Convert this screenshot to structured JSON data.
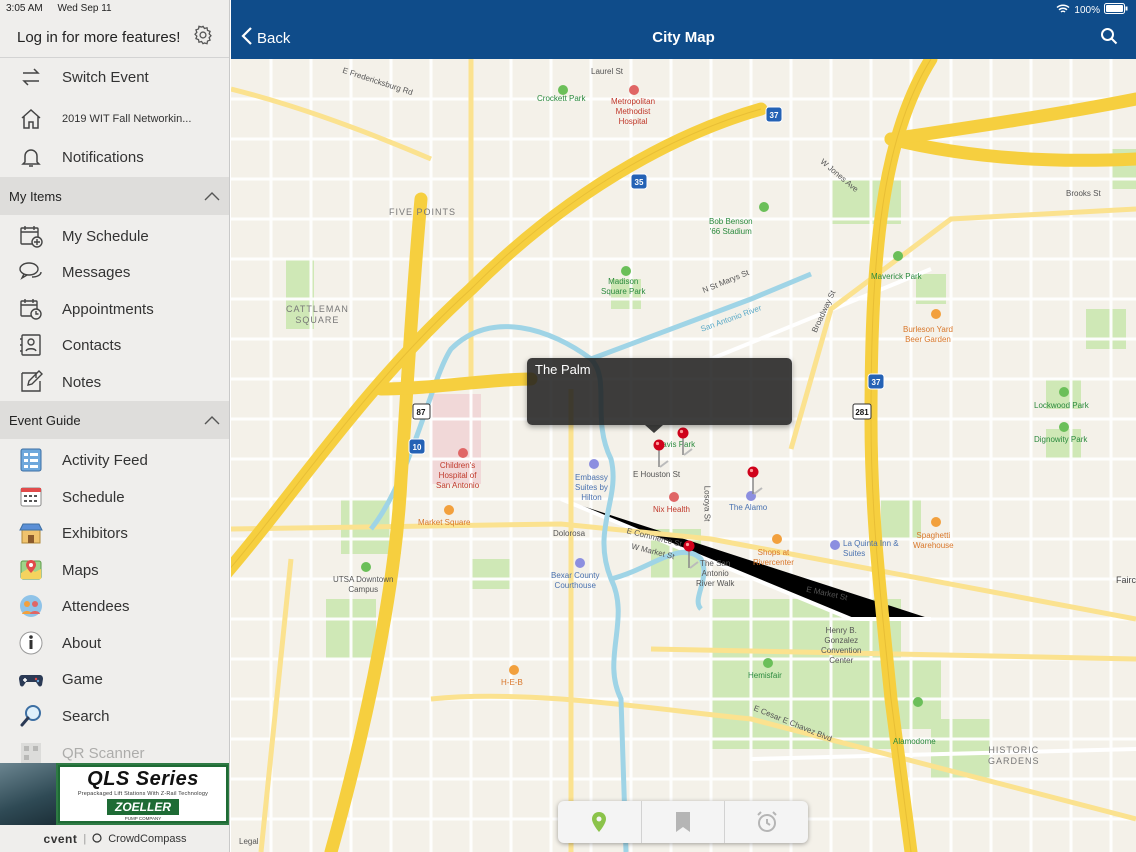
{
  "status_bar": {
    "time": "3:05 AM",
    "date": "Wed Sep 11",
    "battery": "100%"
  },
  "sidebar": {
    "login_text": "Log in for more features!",
    "top_items": [
      {
        "label": "Switch Event",
        "icon": "switch-arrows-icon"
      },
      {
        "label": "2019 WIT Fall Networkin...",
        "icon": "home-icon"
      },
      {
        "label": "Notifications",
        "icon": "bell-icon"
      }
    ],
    "my_items": {
      "title": "My Items",
      "items": [
        {
          "label": "My Schedule",
          "icon": "calendar-plus-icon"
        },
        {
          "label": "Messages",
          "icon": "chat-bubbles-icon"
        },
        {
          "label": "Appointments",
          "icon": "appointment-clock-icon"
        },
        {
          "label": "Contacts",
          "icon": "contact-card-icon"
        },
        {
          "label": "Notes",
          "icon": "notes-pencil-icon"
        }
      ]
    },
    "event_guide": {
      "title": "Event Guide",
      "items": [
        {
          "label": "Activity Feed",
          "icon": "activity-feed-icon"
        },
        {
          "label": "Schedule",
          "icon": "schedule-grid-icon"
        },
        {
          "label": "Exhibitors",
          "icon": "exhibitors-store-icon"
        },
        {
          "label": "Maps",
          "icon": "maps-icon"
        },
        {
          "label": "Attendees",
          "icon": "attendees-icon"
        },
        {
          "label": "About",
          "icon": "info-icon"
        },
        {
          "label": "Game",
          "icon": "gamepad-icon"
        },
        {
          "label": "Search",
          "icon": "search-icon"
        },
        {
          "label": "QR Scanner",
          "icon": "qr-scanner-icon"
        }
      ]
    },
    "ad": {
      "title": "QLS Series",
      "subtitle": "Prepackaged Lift Stations With Z-Rail Technology",
      "brand": "ZOELLER",
      "company": "PUMP COMPANY"
    },
    "footer": {
      "brand1": "cvent",
      "brand2": "CrowdCompass"
    }
  },
  "navbar": {
    "back_label": "Back",
    "title": "City Map"
  },
  "map": {
    "callout_title": "The Palm",
    "legal": "Legal",
    "labels": {
      "laurel": "Laurel St",
      "crockett": "Crockett Park",
      "metro": "Metropolitan\nMethodist\nHospital",
      "fredericksburg": "E Fredericksburg Rd",
      "fivepoints": "FIVE POINTS",
      "cattleman": "CATTLEMAN\nSQUARE",
      "bobbenson": "Bob Benson\n'66 Stadium",
      "madison": "Madison\nSquare Park",
      "maverick": "Maverick Park",
      "burleson": "Burleson Yard\nBeer Garden",
      "childrens": "Children's\nHospital of\nSan Antonio",
      "embassy": "Embassy\nSuites by\nHilton",
      "nix": "Nix Health",
      "alamo": "The Alamo",
      "marketsq": "Market Square",
      "shops": "Shops at\nRivercenter",
      "laquinta": "La Quinta Inn & Suites",
      "spaghetti": "Spaghetti\nWarehouse",
      "utsa": "UTSA Downtown\nCampus",
      "bexar": "Bexar County\nCourthouse",
      "riverwalk": "The San\nAntonio\nRiver Walk",
      "henryb": "Henry B.\nGonzalez\nConvention\nCenter",
      "hemisfair": "Hemisfair",
      "heb": "H-E-B",
      "alamodome": "Alamodome",
      "historic": "HISTORIC\nGARDENS",
      "lockwood": "Lockwood Park",
      "dignowity": "Dignowity Park",
      "travis": "Travis Park",
      "emarket": "E Market St",
      "ecesar": "E Cesar E Chavez Blvd",
      "broadway": "Broadway St",
      "commerce": "E Commerce St",
      "wmarket": "W Market St",
      "houston": "E Houston St",
      "dolorosa": "Dolorosa",
      "loosoya": "Losoya St",
      "nstmarys": "N St Marys St",
      "riverwalk2": "San Antonio River",
      "wjones": "W Jones Ave",
      "brooks": "Brooks St",
      "fairc": "Fairc"
    }
  },
  "toolbar": {
    "items": [
      "location-pin-icon",
      "bookmark-icon",
      "alarm-clock-icon"
    ]
  },
  "colors": {
    "navbar": "#0f4c8a",
    "highway": "#f6cf3f",
    "park": "#cfe8b6",
    "water": "#9fd4e6",
    "pin": "#d0021b"
  }
}
